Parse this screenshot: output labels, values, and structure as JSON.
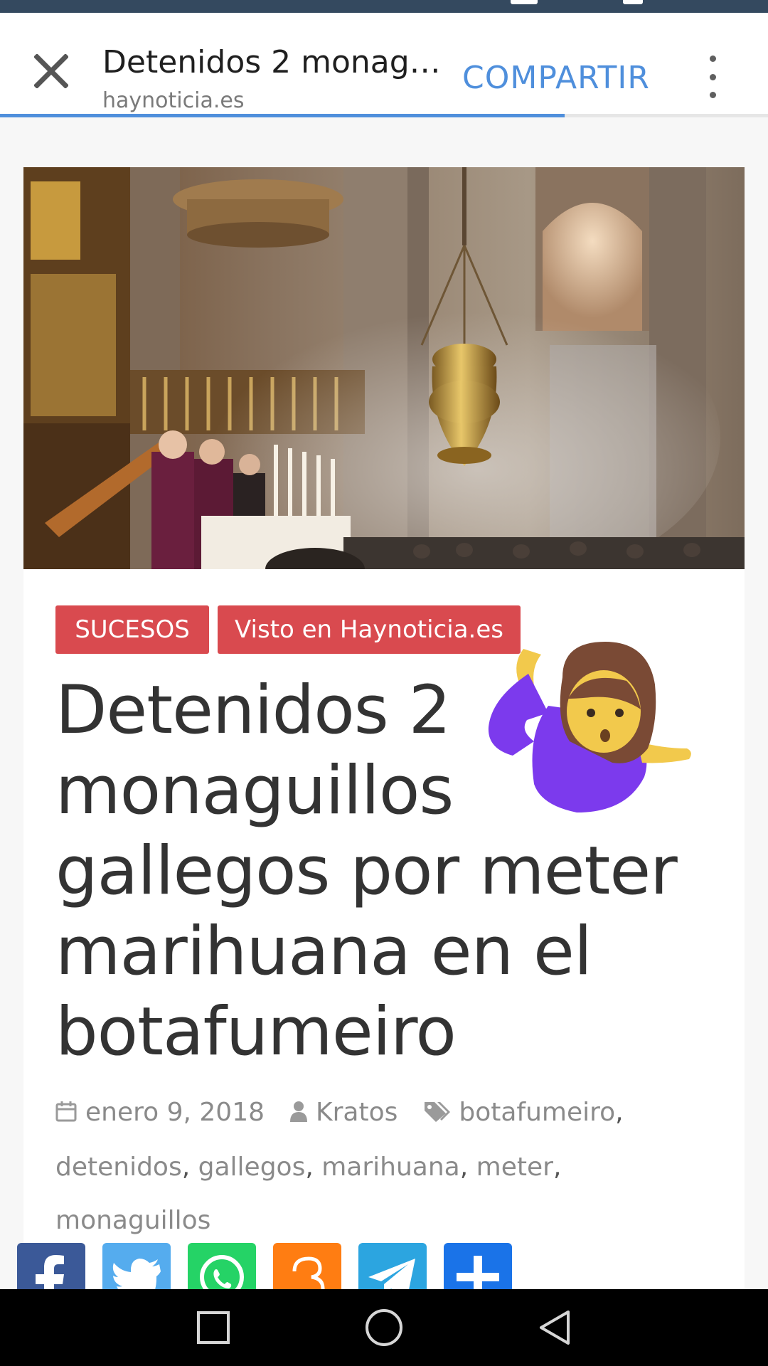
{
  "toolbar": {
    "title": "Detenidos 2 monag…",
    "domain": "haynoticia.es",
    "share_label": "COMPARTIR",
    "load_progress": 0.735
  },
  "article": {
    "categories": [
      "SUCESOS",
      "Visto en Haynoticia.es"
    ],
    "headline_lines": [
      "Detenidos 2",
      "monaguillos",
      "gallegos por meter",
      "marihuana en el",
      "botafumeiro"
    ],
    "date": "enero 9, 2018",
    "author": "Kratos",
    "tags": [
      "botafumeiro",
      "detenidos",
      "gallegos",
      "marihuana",
      "meter",
      "monaguillos"
    ],
    "tag_separator": ","
  },
  "share_buttons": [
    {
      "icon": "facebook-icon",
      "color": "#3b5998"
    },
    {
      "icon": "twitter-icon",
      "color": "#55acee"
    },
    {
      "icon": "whatsapp-icon",
      "color": "#25d366"
    },
    {
      "icon": "meneame-icon",
      "color": "#ff7d12"
    },
    {
      "icon": "telegram-icon",
      "color": "#2ca5e0"
    },
    {
      "icon": "share-plus-icon",
      "color": "#1a73e8"
    }
  ],
  "colors": {
    "accent": "#4f8fdc",
    "category_tag": "#d94a4f",
    "status_bar": "#34495f"
  }
}
